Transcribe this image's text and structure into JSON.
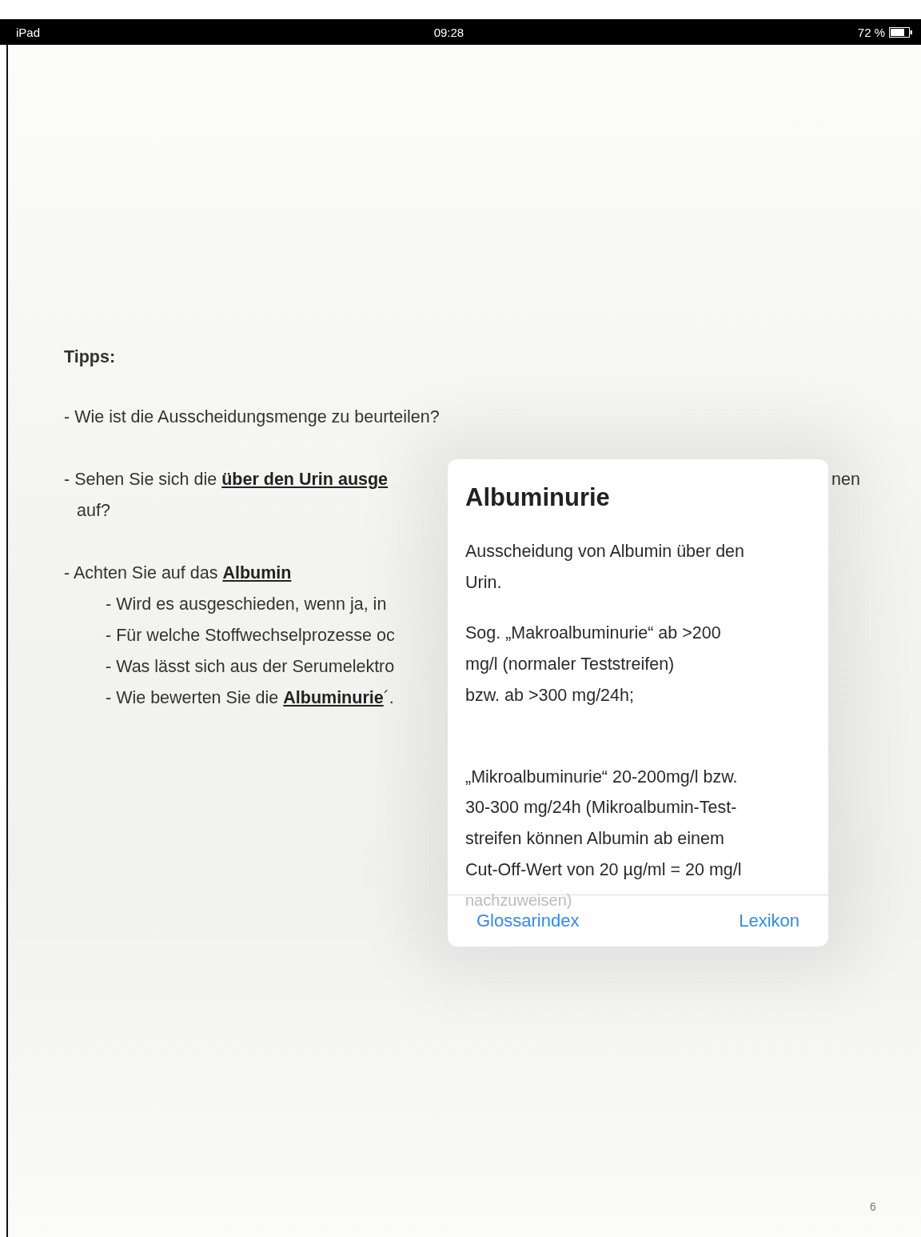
{
  "status_bar": {
    "device": "iPad",
    "time": "09:28",
    "battery": "72 %"
  },
  "document": {
    "heading": "Tipps:",
    "lines": [
      {
        "kind": "item",
        "text": "- Wie ist die Ausscheidungsmenge zu beurteilen?"
      },
      {
        "kind": "split",
        "text": "- Sehen Sie sich die **über den Urin ausge**",
        "tail": "nen"
      },
      {
        "kind": "cont",
        "text": "auf?"
      },
      {
        "kind": "item",
        "text": "- Achten Sie auf das **Albumin**"
      },
      {
        "kind": "sub",
        "text": "- Wird es ausgeschieden, wenn ja, in"
      },
      {
        "kind": "sub",
        "text": "- Für welche Stoffwechselprozesse oc"
      },
      {
        "kind": "sub",
        "text": "- Was lässt sich aus der Serumelektro"
      },
      {
        "kind": "sub",
        "text": "- Wie bewerten Sie die **Albuminurie**´."
      }
    ],
    "page_number": "6"
  },
  "popover": {
    "title": "Albuminurie",
    "paragraphs": [
      [
        "Ausscheidung von Albumin über den",
        "Urin."
      ],
      [
        "Sog. „Makroalbuminurie“ ab >200",
        "mg/l (normaler Teststreifen)",
        "bzw. ab >300 mg/24h;"
      ],
      [
        "„Mikroalbuminurie“ 20-200mg/l bzw.",
        "30-300 mg/24h (Mikroalbumin-Test-",
        "streifen können Albumin ab einem",
        "Cut-Off-Wert von 20 µg/ml = 20 mg/l"
      ]
    ],
    "overflow_text": "nachzuweisen)",
    "buttons": [
      "Glossarindex",
      "Lexikon"
    ]
  }
}
